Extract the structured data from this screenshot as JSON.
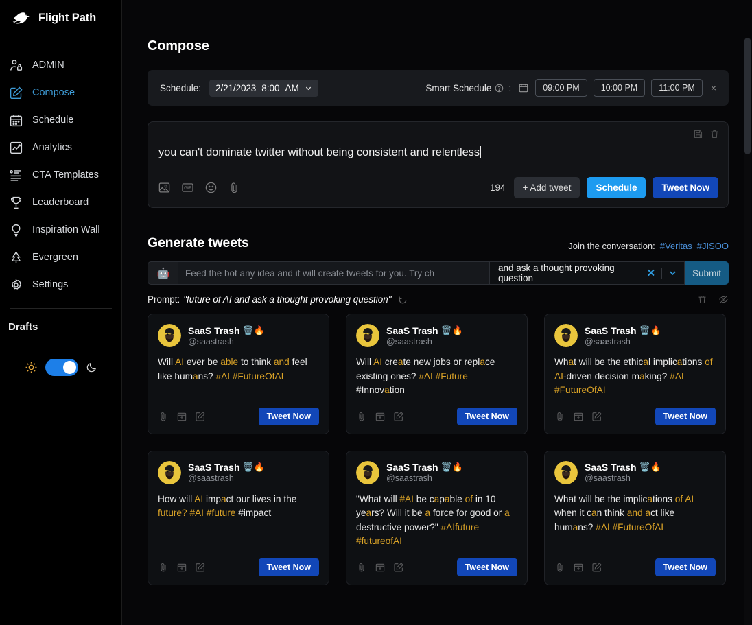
{
  "brand": {
    "name": "Flight Path",
    "logo_icon": "dove-icon"
  },
  "sidebar": {
    "items": [
      {
        "label": "ADMIN",
        "icon": "user-lock-icon",
        "active": false
      },
      {
        "label": "Compose",
        "icon": "pencil-square-icon",
        "active": true
      },
      {
        "label": "Schedule",
        "icon": "calendar-icon",
        "active": false
      },
      {
        "label": "Analytics",
        "icon": "chart-square-icon",
        "active": false
      },
      {
        "label": "CTA Templates",
        "icon": "list-icon",
        "active": false
      },
      {
        "label": "Leaderboard",
        "icon": "trophy-icon",
        "active": false
      },
      {
        "label": "Inspiration Wall",
        "icon": "lightbulb-icon",
        "active": false
      },
      {
        "label": "Evergreen",
        "icon": "tree-icon",
        "active": false
      },
      {
        "label": "Settings",
        "icon": "gear-icon",
        "active": false
      }
    ],
    "drafts_title": "Drafts",
    "theme": {
      "light_icon": "sun-icon",
      "dark_icon": "moon-icon",
      "dark_mode_on": true
    }
  },
  "main": {
    "page_title": "Compose",
    "schedule": {
      "label": "Schedule:",
      "date": "2/21/2023",
      "time": "8:00",
      "meridiem": "AM",
      "smart_schedule_label": "Smart Schedule",
      "smart_help_icon": "question-circle-icon",
      "colon": ":",
      "calendar_icon": "calendar-icon",
      "time_slots": [
        "09:00 PM",
        "10:00 PM",
        "11:00 PM"
      ],
      "clear_label": "×"
    },
    "compose": {
      "text": "you can't dominate twitter without being consistent and relentless",
      "save_icon": "save-icon",
      "delete_icon": "trash-icon",
      "tool_icons": [
        "image-icon",
        "gif-icon",
        "emoji-icon",
        "attachment-icon"
      ],
      "char_count": "194",
      "add_tweet_label": "+ Add tweet",
      "schedule_label": "Schedule",
      "tweet_now_label": "Tweet Now"
    },
    "generate": {
      "title": "Generate tweets",
      "join_label": "Join the conversation:",
      "join_tags": [
        "#Veritas",
        "#JISOO"
      ],
      "bot_icon": "robot-icon",
      "input_placeholder": "Feed the bot any idea and it will create tweets for you. Try ch",
      "suffix_value": "and ask a thought provoking question",
      "suffix_clear_icon": "close-x-icon",
      "suffix_dropdown_icon": "chevron-down-icon",
      "submit_label": "Submit",
      "prompt_label": "Prompt:",
      "prompt_value": "\"future of AI and ask a thought provoking question\"",
      "refresh_icon": "spinner-icon",
      "delete_icon": "trash-icon",
      "hide_icon": "eye-off-icon"
    },
    "tweet_cards": [
      {
        "display_name": "SaaS Trash",
        "emojis": "🗑️🔥",
        "handle": "@saastrash",
        "segments": [
          {
            "t": "Will ",
            "hl": false
          },
          {
            "t": "AI",
            "hl": true
          },
          {
            "t": " ever be ",
            "hl": false
          },
          {
            "t": "able",
            "hl": true
          },
          {
            "t": " to think ",
            "hl": false
          },
          {
            "t": "and",
            "hl": true
          },
          {
            "t": " feel like hum",
            "hl": false
          },
          {
            "t": "a",
            "hl": true
          },
          {
            "t": "ns? ",
            "hl": false
          },
          {
            "t": "#AI #FutureOfAI",
            "hl": true
          }
        ],
        "button_label": "Tweet Now"
      },
      {
        "display_name": "SaaS Trash",
        "emojis": "🗑️🔥",
        "handle": "@saastrash",
        "segments": [
          {
            "t": "Will ",
            "hl": false
          },
          {
            "t": "AI",
            "hl": true
          },
          {
            "t": " cre",
            "hl": false
          },
          {
            "t": "a",
            "hl": true
          },
          {
            "t": "te new jobs or repl",
            "hl": false
          },
          {
            "t": "a",
            "hl": true
          },
          {
            "t": "ce existing ones? ",
            "hl": false
          },
          {
            "t": "#AI #Future",
            "hl": true
          },
          {
            "t": " #Innov",
            "hl": false
          },
          {
            "t": "a",
            "hl": true
          },
          {
            "t": "tion",
            "hl": false
          }
        ],
        "button_label": "Tweet Now"
      },
      {
        "display_name": "SaaS Trash",
        "emojis": "🗑️🔥",
        "handle": "@saastrash",
        "segments": [
          {
            "t": "Wh",
            "hl": false
          },
          {
            "t": "a",
            "hl": true
          },
          {
            "t": "t will be the ethic",
            "hl": false
          },
          {
            "t": "a",
            "hl": true
          },
          {
            "t": "l implic",
            "hl": false
          },
          {
            "t": "a",
            "hl": true
          },
          {
            "t": "tions ",
            "hl": false
          },
          {
            "t": "of AI",
            "hl": true
          },
          {
            "t": "-driven decision m",
            "hl": false
          },
          {
            "t": "a",
            "hl": true
          },
          {
            "t": "king? ",
            "hl": false
          },
          {
            "t": "#AI #FutureOfAI",
            "hl": true
          }
        ],
        "button_label": "Tweet Now"
      },
      {
        "display_name": "SaaS Trash",
        "emojis": "🗑️🔥",
        "handle": "@saastrash",
        "segments": [
          {
            "t": "How will ",
            "hl": false
          },
          {
            "t": "AI",
            "hl": true
          },
          {
            "t": " imp",
            "hl": false
          },
          {
            "t": "a",
            "hl": true
          },
          {
            "t": "ct our lives in the ",
            "hl": false
          },
          {
            "t": "future?",
            "hl": true
          },
          {
            "t": " ",
            "hl": false
          },
          {
            "t": "#AI #future",
            "hl": true
          },
          {
            "t": " #impact",
            "hl": false
          }
        ],
        "button_label": "Tweet Now"
      },
      {
        "display_name": "SaaS Trash",
        "emojis": "🗑️🔥",
        "handle": "@saastrash",
        "segments": [
          {
            "t": "\"What will ",
            "hl": false
          },
          {
            "t": "#AI",
            "hl": true
          },
          {
            "t": " be c",
            "hl": false
          },
          {
            "t": "a",
            "hl": true
          },
          {
            "t": "p",
            "hl": false
          },
          {
            "t": "a",
            "hl": true
          },
          {
            "t": "ble ",
            "hl": false
          },
          {
            "t": "of",
            "hl": true
          },
          {
            "t": " in 10 ye",
            "hl": false
          },
          {
            "t": "a",
            "hl": true
          },
          {
            "t": "rs? Will it be ",
            "hl": false
          },
          {
            "t": "a",
            "hl": true
          },
          {
            "t": " force for good or ",
            "hl": false
          },
          {
            "t": "a",
            "hl": true
          },
          {
            "t": " destructive power?\" ",
            "hl": false
          },
          {
            "t": "#AIfuture #futureofAI",
            "hl": true
          }
        ],
        "button_label": "Tweet Now"
      },
      {
        "display_name": "SaaS Trash",
        "emojis": "🗑️🔥",
        "handle": "@saastrash",
        "segments": [
          {
            "t": "What will be the implic",
            "hl": false
          },
          {
            "t": "a",
            "hl": true
          },
          {
            "t": "tions ",
            "hl": false
          },
          {
            "t": "of AI",
            "hl": true
          },
          {
            "t": " when it c",
            "hl": false
          },
          {
            "t": "a",
            "hl": true
          },
          {
            "t": "n think ",
            "hl": false
          },
          {
            "t": "and",
            "hl": true
          },
          {
            "t": " ",
            "hl": false
          },
          {
            "t": "a",
            "hl": true
          },
          {
            "t": "ct like hum",
            "hl": false
          },
          {
            "t": "a",
            "hl": true
          },
          {
            "t": "ns? ",
            "hl": false
          },
          {
            "t": "#AI #FutureOfAI",
            "hl": true
          }
        ],
        "button_label": "Tweet Now"
      }
    ]
  },
  "colors": {
    "accent_blue": "#1d9bf0",
    "tweet_blue": "#1247b8",
    "highlight_gold": "#d9a227",
    "sidebar_active": "#3d9bd6",
    "background": "#000000"
  }
}
